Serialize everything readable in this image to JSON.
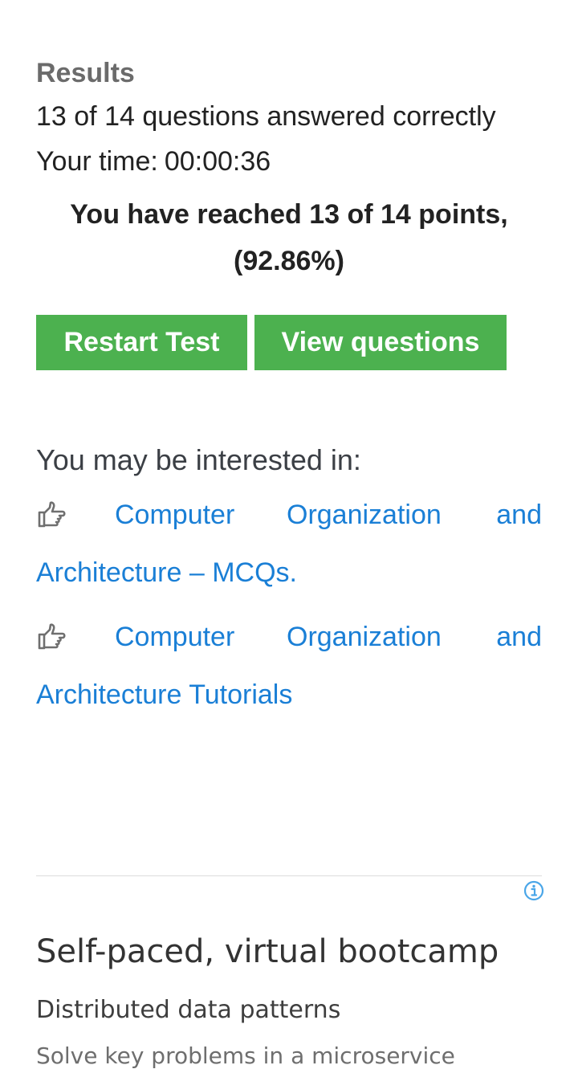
{
  "results": {
    "heading": "Results",
    "correct_summary": "13 of 14 questions answered correctly",
    "time_label": "Your time:",
    "time_value": "00:00:36",
    "points_summary": "You have reached 13 of 14 points,",
    "percentage": "(92.86%)"
  },
  "buttons": {
    "restart_label": "Restart Test",
    "view_label": "View questions"
  },
  "recommendations": {
    "heading": "You may be interested in:",
    "items": [
      {
        "icon": "hand-pointing-icon",
        "words": [
          "Computer",
          "Organization",
          "and"
        ],
        "line2": "Architecture – MCQs."
      },
      {
        "icon": "hand-pointing-icon",
        "words": [
          "Computer",
          "Organization",
          "and"
        ],
        "line2": "Architecture Tutorials"
      }
    ]
  },
  "ad": {
    "info_icon": "info-icon",
    "title": "Self-paced, virtual bootcamp",
    "subtitle": "Distributed data patterns",
    "body": "Solve key problems in a microservice"
  },
  "colors": {
    "button_green": "#4cb14f",
    "link_blue": "#1a7fd6",
    "heading_gray": "#6b6b6b",
    "info_blue": "#4aa6e8"
  }
}
